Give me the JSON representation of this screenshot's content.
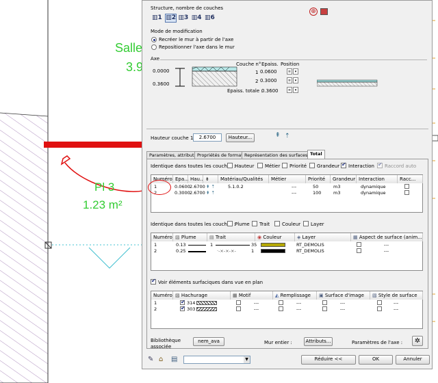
{
  "cad": {
    "room_name": "Salle",
    "room_value": "3.9",
    "pl_label": "Pl 3",
    "pl_area": "1.23 m²"
  },
  "dialog": {
    "structure_title": "Structure, nombre de couches",
    "layer_buttons": [
      "1",
      "2",
      "3",
      "4",
      "6"
    ],
    "mode_title": "Mode de modification",
    "mode_options": [
      "Recréer le mur à partir de l'axe",
      "Repositionner l'axe dans le mur"
    ],
    "axe_title": "Axe",
    "axe_values": [
      "0.0000",
      "0.3600"
    ],
    "layer_headers": {
      "num": "Couche n°",
      "thick": "Epaiss.",
      "pos": "Position"
    },
    "layers": [
      {
        "num": "1",
        "thick": "0.0600"
      },
      {
        "num": "2",
        "thick": "0.3000"
      }
    ],
    "total_label": "Epaiss. totale :",
    "total_value": "0.3600",
    "hauteur_label": "Hauteur couche 1 :",
    "hauteur_value": "2.6700",
    "hauteur_button": "Hauteur...",
    "tabs": [
      "Paramètres, attributs",
      "Propriétés de format",
      "Représentation des surfaces",
      "Total"
    ],
    "identique1_label": "Identique dans toutes les couches :",
    "identique1_options": [
      {
        "label": "Hauteur",
        "checked": false
      },
      {
        "label": "Métier",
        "checked": false
      },
      {
        "label": "Priorité",
        "checked": false
      },
      {
        "label": "Grandeur",
        "checked": false
      },
      {
        "label": "Interaction",
        "checked": true
      },
      {
        "label": "Raccord auto",
        "checked": true
      }
    ],
    "table1_headers": [
      "Numéro",
      "Epa...",
      "Hau...",
      "",
      "Matériau/Qualités",
      "Métier",
      "Priorité",
      "Grandeur",
      "Interaction",
      "Racc..."
    ],
    "table1_rows": [
      {
        "num": "1",
        "epa": "0.0600",
        "hau": "2.6700",
        "mat": "5.1.0.2",
        "metier": "---",
        "prio": "50",
        "grand": "m3",
        "inter": "dynamique"
      },
      {
        "num": "2",
        "epa": "0.3000",
        "hau": "2.6700",
        "mat": "",
        "metier": "---",
        "prio": "100",
        "grand": "m3",
        "inter": "dynamique"
      }
    ],
    "identique2_label": "Identique dans toutes les couches :",
    "identique2_options": [
      "Plume",
      "Trait",
      "Couleur",
      "Layer"
    ],
    "table2_headers": [
      "Numéro",
      "Plume",
      "Trait",
      "Couleur",
      "Layer",
      "Aspect de surface (anim..."
    ],
    "table2_rows": [
      {
        "num": "1",
        "plume": "0.13",
        "trait": "1",
        "couleur": "35",
        "color": "#b5a800",
        "layer": "RT_DEMOLIS",
        "aspect": "---"
      },
      {
        "num": "2",
        "plume": "0.25",
        "trait": "1",
        "couleur": "1",
        "color": "#000000",
        "layer": "RT_DEMOLIS",
        "aspect": "---"
      }
    ],
    "voir_label": "Voir éléments surfaciques dans vue en plan",
    "table3_headers": [
      "Numéro",
      "Hachurage",
      "Motif",
      "Remplissage",
      "Surface d'image",
      "Style de surface"
    ],
    "table3_rows": [
      {
        "num": "1",
        "hach": "314",
        "motif": "---",
        "rempl": "---",
        "surf": "---",
        "style": "---"
      },
      {
        "num": "2",
        "hach": "303",
        "motif": "---",
        "rempl": "---",
        "surf": "---",
        "style": "---"
      }
    ],
    "biblio_label_1": "Bibliothèque",
    "biblio_label_2": "associée",
    "biblio_button": "nem_ava",
    "mur_label": "Mur entier :",
    "attributs_button": "Attributs...",
    "params_label": "Paramètres de l'axe :",
    "reduire_button": "Réduire <<",
    "ok_button": "OK",
    "annuler_button": "Annuler"
  }
}
